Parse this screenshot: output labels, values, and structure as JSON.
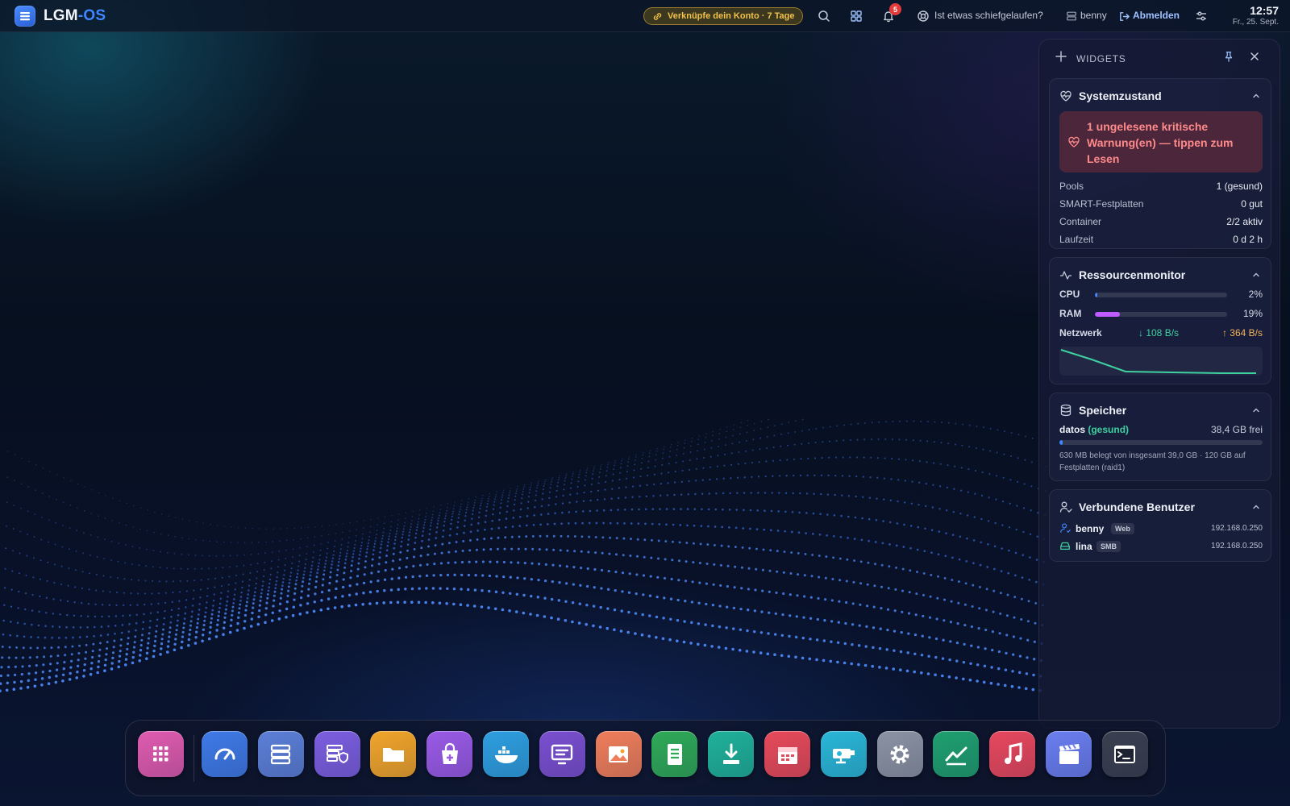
{
  "topbar": {
    "logo_part1": "LGM",
    "logo_part2": "-OS",
    "account_banner": "Verknüpfe dein Konto · 7 Tage",
    "notification_count": "5",
    "help_label": "Ist etwas schiefgelaufen?",
    "user_label": "benny",
    "logout_label": "Abmelden",
    "time": "12:57",
    "date": "Fr., 25. Sept."
  },
  "widgets": {
    "title": "WIDGETS",
    "system": {
      "title": "Systemzustand",
      "alert": "1 ungelesene kritische Warnung(en) — tippen zum Lesen",
      "rows": [
        {
          "key": "Pools",
          "value": "1 (gesund)"
        },
        {
          "key": "SMART-Festplatten",
          "value": "0 gut"
        },
        {
          "key": "Container",
          "value": "2/2 aktiv"
        },
        {
          "key": "Laufzeit",
          "value": "0 d 2 h"
        }
      ]
    },
    "resources": {
      "title": "Ressourcenmonitor",
      "cpu_label": "CPU",
      "cpu_value": "2%",
      "cpu_fraction": 0.02,
      "ram_label": "RAM",
      "ram_value": "19%",
      "ram_fraction": 0.19,
      "net_label": "Netzwerk",
      "net_down": "↓ 108 B/s",
      "net_up": "↑ 364 B/s",
      "colors": {
        "cpu": "#3f86ff",
        "ram": "#c05bff",
        "net": "#3fd0a0"
      }
    },
    "storage": {
      "title": "Speicher",
      "pool_name": "datos",
      "pool_health": "(gesund)",
      "free": "38,4 GB frei",
      "used_fraction": 0.016,
      "note": "630 MB belegt von insgesamt 39,0 GB · 120 GB auf Festplatten (raid1)"
    },
    "users": {
      "title": "Verbundene Benutzer",
      "items": [
        {
          "name": "benny",
          "tag": "Web",
          "ip": "192.168.0.250",
          "icon": "user-icon"
        },
        {
          "name": "lina",
          "tag": "SMB",
          "ip": "192.168.0.250",
          "icon": "drive-icon"
        }
      ]
    }
  },
  "dock": {
    "apps": [
      {
        "name": "app-launcher",
        "icon": "grid-icon",
        "color": "#e05bb0"
      },
      {
        "name": "dashboard",
        "icon": "gauge-icon",
        "color": "#3f7ae8"
      },
      {
        "name": "storage-manager",
        "icon": "server-icon",
        "color": "#5c7fd8"
      },
      {
        "name": "security",
        "icon": "server-shield-icon",
        "color": "#7c5ee0"
      },
      {
        "name": "file-manager",
        "icon": "folder-icon",
        "color": "#f2a52a"
      },
      {
        "name": "app-store",
        "icon": "shopping-bag-icon",
        "color": "#9a5ae6"
      },
      {
        "name": "docker",
        "icon": "whale-icon",
        "color": "#2e9fe0"
      },
      {
        "name": "remote-desktop",
        "icon": "monitor-icon",
        "color": "#7a4fd0"
      },
      {
        "name": "photos",
        "icon": "image-icon",
        "color": "#f07e5a"
      },
      {
        "name": "notes",
        "icon": "document-icon",
        "color": "#2faa58"
      },
      {
        "name": "downloads",
        "icon": "download-icon",
        "color": "#1fb29a"
      },
      {
        "name": "calendar",
        "icon": "calendar-icon",
        "color": "#e84a5a"
      },
      {
        "name": "camera",
        "icon": "camera-icon",
        "color": "#2ab7d8"
      },
      {
        "name": "settings",
        "icon": "gear-icon",
        "color": "#8c93a4"
      },
      {
        "name": "monitor",
        "icon": "chart-line-icon",
        "color": "#1fa070"
      },
      {
        "name": "music",
        "icon": "music-icon",
        "color": "#e8485e"
      },
      {
        "name": "video",
        "icon": "clapperboard-icon",
        "color": "#6a7ef0"
      },
      {
        "name": "terminal",
        "icon": "terminal-icon",
        "color": "#3a4050"
      }
    ]
  }
}
